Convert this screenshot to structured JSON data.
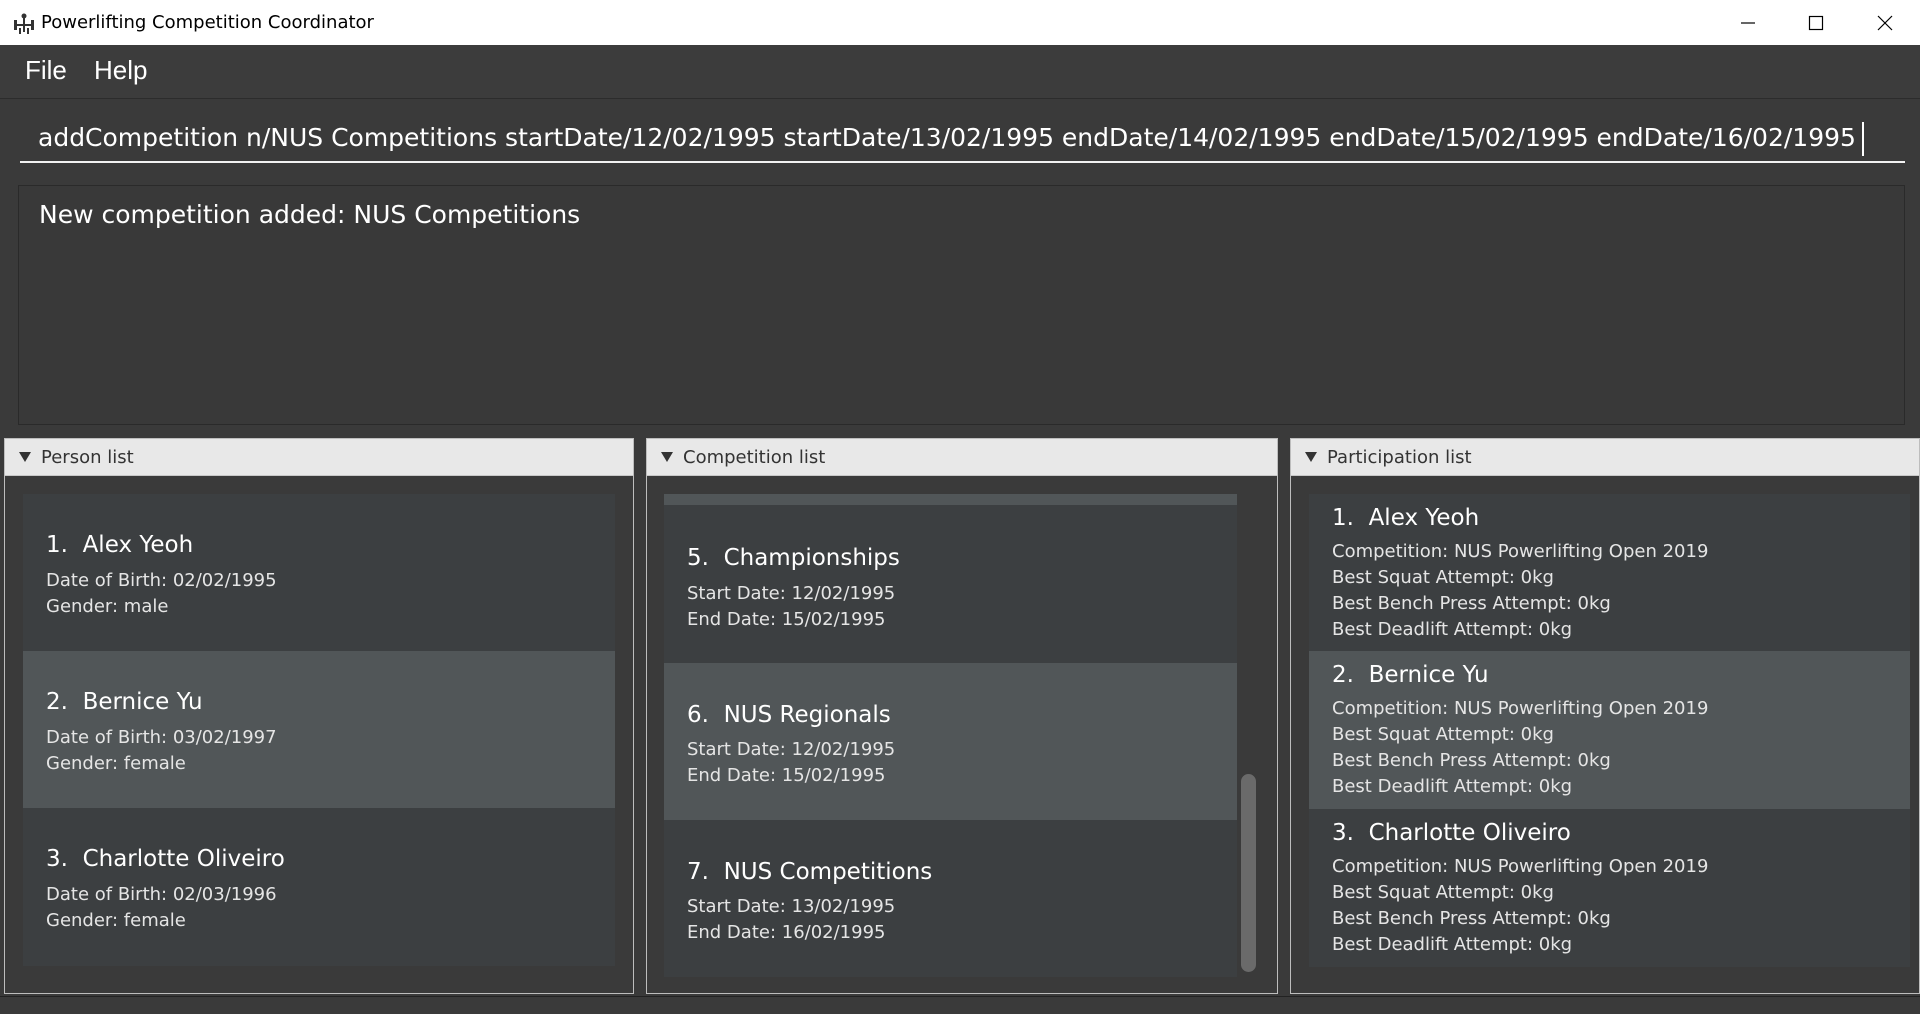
{
  "window": {
    "title": "Powerlifting Competition Coordinator"
  },
  "menu": {
    "file": "File",
    "help": "Help"
  },
  "command": {
    "value": "addCompetition n/NUS Competitions startDate/12/02/1995 startDate/13/02/1995 endDate/14/02/1995 endDate/15/02/1995 endDate/16/02/1995"
  },
  "result": {
    "text": "New competition added: NUS Competitions"
  },
  "person_list": {
    "header": "Person list",
    "items": [
      {
        "index": "1.",
        "name": "Alex Yeoh",
        "dob": "Date of Birth: 02/02/1995",
        "gender": "Gender: male"
      },
      {
        "index": "2.",
        "name": "Bernice Yu",
        "dob": "Date of Birth: 03/02/1997",
        "gender": "Gender: female"
      },
      {
        "index": "3.",
        "name": "Charlotte Oliveiro",
        "dob": "Date of Birth: 02/03/1996",
        "gender": "Gender: female"
      }
    ]
  },
  "competition_list": {
    "header": "Competition list",
    "items": [
      {
        "index": "5.",
        "name": "Championships",
        "start": "Start Date: 12/02/1995",
        "end": "End Date: 15/02/1995"
      },
      {
        "index": "6.",
        "name": "NUS Regionals",
        "start": "Start Date: 12/02/1995",
        "end": "End Date: 15/02/1995"
      },
      {
        "index": "7.",
        "name": "NUS Competitions",
        "start": "Start Date: 13/02/1995",
        "end": "End Date: 16/02/1995"
      }
    ]
  },
  "participation_list": {
    "header": "Participation list",
    "items": [
      {
        "index": "1.",
        "name": "Alex Yeoh",
        "competition": "Competition: NUS Powerlifting Open 2019",
        "squat": "Best Squat Attempt: 0kg",
        "bench": "Best Bench Press Attempt: 0kg",
        "deadlift": "Best Deadlift Attempt: 0kg"
      },
      {
        "index": "2.",
        "name": "Bernice Yu",
        "competition": "Competition: NUS Powerlifting Open 2019",
        "squat": "Best Squat Attempt: 0kg",
        "bench": "Best Bench Press Attempt: 0kg",
        "deadlift": "Best Deadlift Attempt: 0kg"
      },
      {
        "index": "3.",
        "name": "Charlotte Oliveiro",
        "competition": "Competition: NUS Powerlifting Open 2019",
        "squat": "Best Squat Attempt: 0kg",
        "bench": "Best Bench Press Attempt: 0kg",
        "deadlift": "Best Deadlift Attempt: 0kg"
      }
    ]
  },
  "icons": {
    "app": "barbell-icon",
    "minimize": "minimize-icon",
    "maximize": "maximize-icon",
    "close": "close-icon",
    "collapse": "triangle-down-icon"
  }
}
